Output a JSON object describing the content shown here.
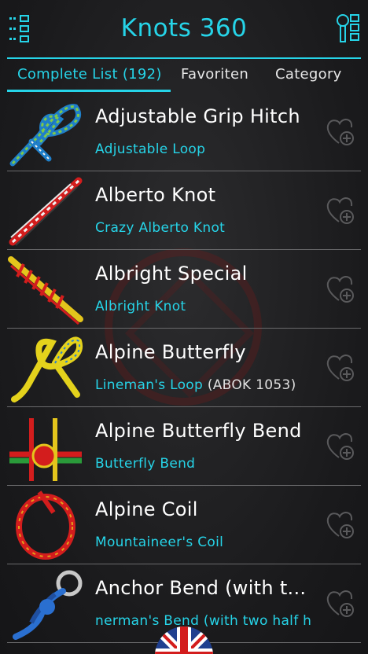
{
  "app": {
    "title": "Knots 360"
  },
  "toolbar": {
    "menu_icon": "list-menu-icon",
    "tools_icon": "tools-icon"
  },
  "tabs": [
    {
      "label": "Complete List (192)",
      "active": true
    },
    {
      "label": "Favoriten",
      "active": false
    },
    {
      "label": "Category",
      "active": false
    }
  ],
  "knots": [
    {
      "name": "Adjustable Grip Hitch",
      "alt": "Adjustable Loop",
      "extra": "",
      "colors": [
        "#1f7fc9",
        "#7ec94a",
        "#f2f2f2"
      ]
    },
    {
      "name": "Alberto Knot",
      "alt": "Crazy Alberto Knot",
      "extra": "",
      "colors": [
        "#d31d1d",
        "#f2f2f2",
        "#3a3a3a"
      ]
    },
    {
      "name": "Albright Special",
      "alt": "Albright Knot",
      "extra": "",
      "colors": [
        "#e4c51c",
        "#d31d1d",
        "#f2f2f2"
      ]
    },
    {
      "name": "Alpine Butterfly",
      "alt": "Lineman's Loop",
      "extra": "(ABOK 1053)",
      "colors": [
        "#e4d21c",
        "#2a7fd0",
        "#f2f2f2"
      ]
    },
    {
      "name": "Alpine Butterfly Bend",
      "alt": "Butterfly Bend",
      "extra": "",
      "colors": [
        "#d31d1d",
        "#2a9a3a",
        "#e4c51c"
      ]
    },
    {
      "name": "Alpine Coil",
      "alt": "Mountaineer's Coil",
      "extra": "",
      "colors": [
        "#d31d1d",
        "#e4a01c",
        "#3a3a3a"
      ]
    },
    {
      "name": "Anchor Bend (with t...",
      "alt": "nerman's Bend (with two half h",
      "extra": "",
      "colors": [
        "#2a6fd0",
        "#1f4fa0",
        "#c8c8c8"
      ]
    }
  ],
  "icons": {
    "favorite": "heart-add-icon",
    "language": "uk-flag-icon"
  },
  "accent_color": "#26d4e8"
}
